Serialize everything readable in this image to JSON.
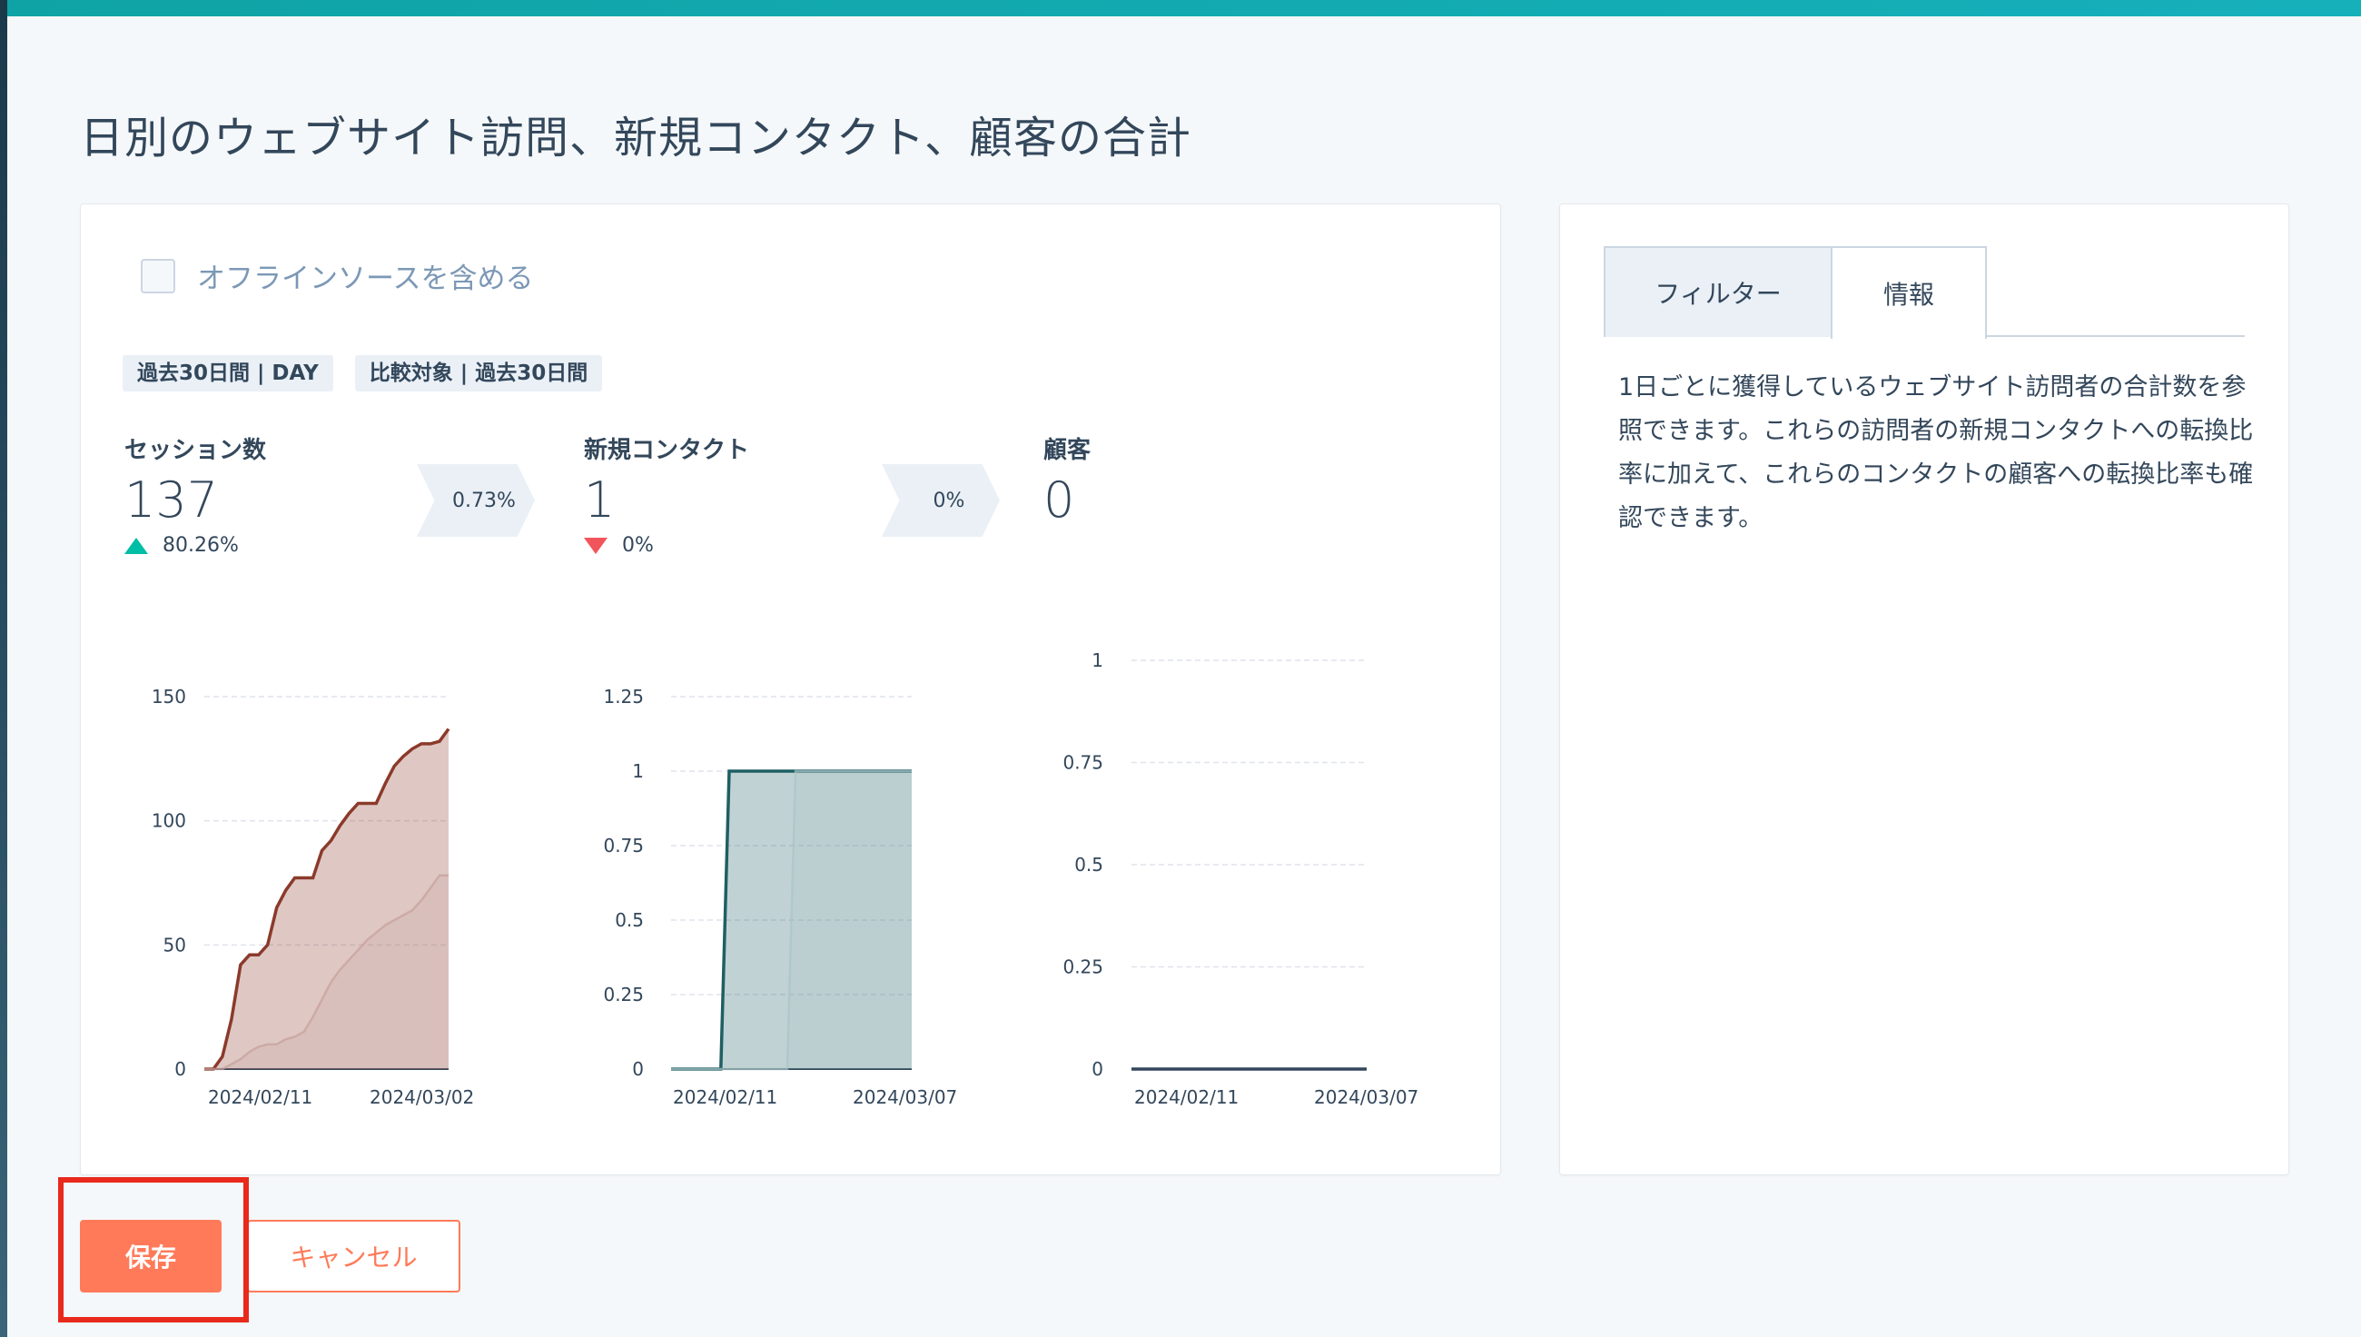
{
  "page": {
    "title": "日別のウェブサイト訪問、新規コンタクト、顧客の合計"
  },
  "main_card": {
    "checkbox_label": "オフラインソースを含める",
    "checkbox_checked": false,
    "tags": [
      "過去30日間 | DAY",
      "比較対象 | 過去30日間"
    ],
    "metrics": [
      {
        "title": "セッション数",
        "value": "137",
        "change": "80.26%",
        "direction": "up"
      },
      {
        "title": "新規コンタクト",
        "value": "1",
        "change": "0%",
        "direction": "down"
      },
      {
        "title": "顧客",
        "value": "0",
        "change": "",
        "direction": ""
      }
    ],
    "conversion_rates": [
      "0.73%",
      "0%"
    ]
  },
  "chart_data": [
    {
      "type": "area",
      "x_tick_labels": [
        "2024/02/11",
        "2024/03/02"
      ],
      "y_ticks": [
        "0",
        "50",
        "100",
        "150"
      ],
      "ylim": [
        0,
        150
      ],
      "grid": true,
      "series": [
        {
          "values": [
            0,
            0,
            5,
            20,
            42,
            46,
            46,
            50,
            65,
            72,
            77,
            77,
            77,
            88,
            92,
            98,
            103,
            107,
            107,
            107,
            115,
            122,
            126,
            129,
            131,
            131,
            132,
            137
          ],
          "color": "#8b3a2b"
        },
        {
          "values": [
            0,
            0,
            0,
            2,
            4,
            7,
            9,
            10,
            10,
            12,
            13,
            15,
            21,
            28,
            35,
            40,
            44,
            48,
            52,
            55,
            58,
            60,
            62,
            64,
            68,
            73,
            78,
            78
          ],
          "color": "#c6a09a"
        }
      ]
    },
    {
      "type": "area",
      "x_tick_labels": [
        "2024/02/11",
        "2024/03/07"
      ],
      "y_ticks": [
        "0",
        "0.25",
        "0.5",
        "0.75",
        "1",
        "1.25"
      ],
      "ylim": [
        0,
        1.25
      ],
      "grid": true,
      "series": [
        {
          "values": [
            0,
            0,
            0,
            0,
            0,
            0,
            0,
            1,
            1,
            1,
            1,
            1,
            1,
            1,
            1,
            1,
            1,
            1,
            1,
            1,
            1,
            1,
            1,
            1,
            1,
            1,
            1,
            1,
            1,
            1
          ],
          "color": "#1f5f63"
        },
        {
          "values": [
            0,
            0,
            0,
            0,
            0,
            0,
            0,
            0,
            0,
            0,
            0,
            0,
            0,
            0,
            0,
            1,
            1,
            1,
            1,
            1,
            1,
            1,
            1,
            1,
            1,
            1,
            1,
            1,
            1,
            1
          ],
          "color": "#a9c4c6"
        }
      ]
    },
    {
      "type": "area",
      "x_tick_labels": [
        "2024/02/11",
        "2024/03/07"
      ],
      "y_ticks": [
        "0",
        "0.25",
        "0.5",
        "0.75",
        "1"
      ],
      "ylim": [
        0,
        1
      ],
      "grid": true,
      "series": [
        {
          "values": [
            0,
            0,
            0,
            0,
            0,
            0,
            0,
            0,
            0,
            0,
            0,
            0,
            0,
            0,
            0,
            0,
            0,
            0,
            0,
            0,
            0,
            0,
            0,
            0,
            0,
            0,
            0,
            0,
            0,
            0
          ],
          "color": "#33475b"
        }
      ]
    }
  ],
  "side_card": {
    "tabs": [
      "フィルター",
      "情報"
    ],
    "active_tab": "情報",
    "info_text": "1日ごとに獲得しているウェブサイト訪問者の合計数を参照できます。これらの訪問者の新規コンタクトへの転換比率に加えて、これらのコンタクトの顧客への転換比率も確認できます。"
  },
  "actions": {
    "save_label": "保存",
    "cancel_label": "キャンセル"
  },
  "colors": {
    "accent": "#ff7a59",
    "highlight": "#e8291c",
    "up": "#00bda5",
    "down": "#f2545b"
  }
}
